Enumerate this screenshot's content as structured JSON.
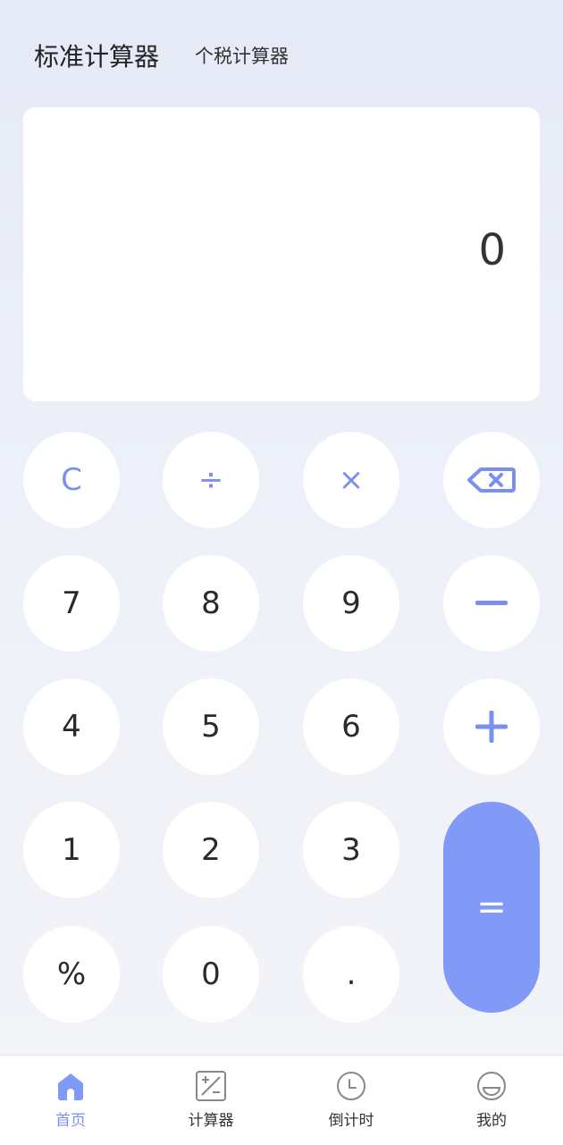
{
  "header": {
    "tabs": [
      {
        "label": "标准计算器",
        "active": true
      },
      {
        "label": "个税计算器",
        "active": false
      }
    ]
  },
  "display": {
    "value": "0"
  },
  "keypad": {
    "clear": "C",
    "divide": "÷",
    "multiply": "×",
    "backspace_icon": "backspace-icon",
    "seven": "7",
    "eight": "8",
    "nine": "9",
    "minus_icon": "minus-icon",
    "four": "4",
    "five": "5",
    "six": "6",
    "plus_icon": "plus-icon",
    "one": "1",
    "two": "2",
    "three": "3",
    "equals": "=",
    "percent": "%",
    "zero": "0",
    "dot": "."
  },
  "bottom_nav": {
    "items": [
      {
        "label": "首页",
        "icon": "home-icon",
        "active": true
      },
      {
        "label": "计算器",
        "icon": "calculator-icon",
        "active": false
      },
      {
        "label": "倒计时",
        "icon": "clock-icon",
        "active": false
      },
      {
        "label": "我的",
        "icon": "smile-face-icon",
        "active": false
      }
    ]
  },
  "colors": {
    "accent": "#8199f7",
    "operator_text": "#7b8ff0",
    "background_top": "#e6eaf7",
    "background_bottom": "#f3f4f8",
    "key_background": "#ffffff"
  }
}
